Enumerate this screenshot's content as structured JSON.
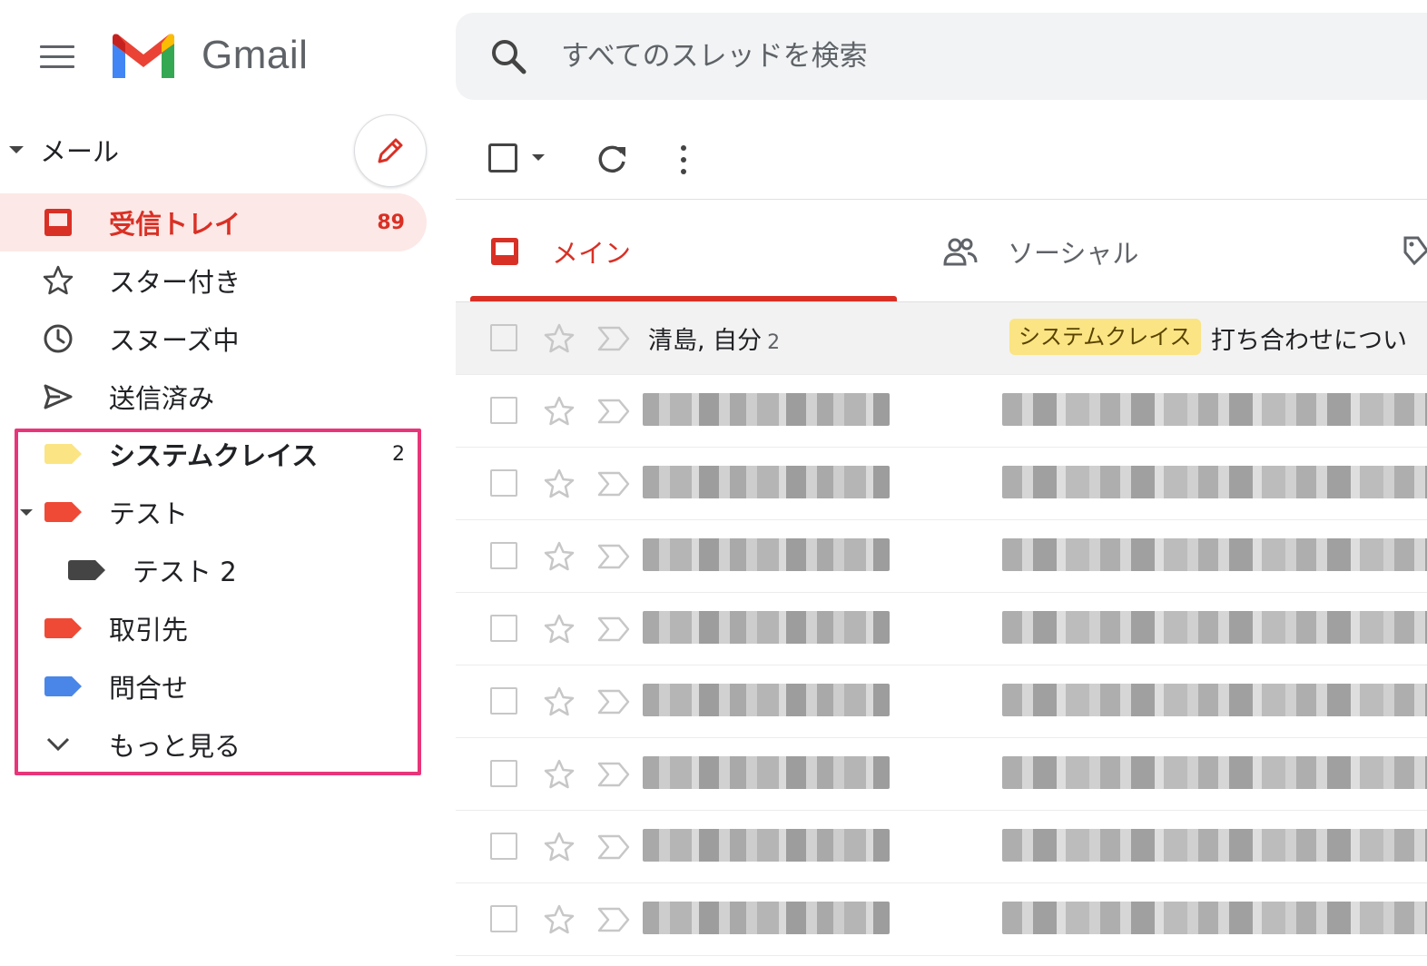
{
  "app": {
    "brand": "Gmail"
  },
  "search": {
    "placeholder": "すべてのスレッドを検索"
  },
  "sidebar": {
    "section_label": "メール",
    "items": [
      {
        "label": "受信トレイ",
        "count": "89",
        "icon": "inbox-icon",
        "active": true
      },
      {
        "label": "スター付き",
        "icon": "star-icon"
      },
      {
        "label": "スヌーズ中",
        "icon": "clock-icon"
      },
      {
        "label": "送信済み",
        "icon": "send-icon"
      }
    ],
    "labels": [
      {
        "label": "システムクレイス",
        "count": "2",
        "color": "#fbe483"
      },
      {
        "label": "テスト",
        "color": "#ef4a36"
      },
      {
        "label": "テスト 2",
        "color": "#444444"
      },
      {
        "label": "取引先",
        "color": "#ef4a36"
      },
      {
        "label": "問合せ",
        "color": "#4a86e8"
      }
    ],
    "more_label": "もっと見る",
    "highlight_color": "#e8357a"
  },
  "tabs": [
    {
      "label": "メイン",
      "icon": "inbox-icon",
      "active": true
    },
    {
      "label": "ソーシャル",
      "icon": "people-icon"
    }
  ],
  "emails": {
    "first": {
      "sender": "清島, 自分",
      "thread_count": "2",
      "label": "システムクレイス",
      "subject": "打ち合わせについ"
    }
  },
  "colors": {
    "accent": "#d93025",
    "active_bg": "#fce8e6"
  }
}
